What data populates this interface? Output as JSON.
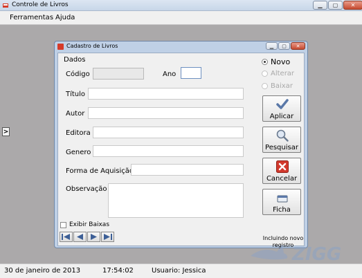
{
  "window": {
    "title": "Controle de Livros"
  },
  "menu": {
    "items": [
      "Ferramentas",
      "Ajuda"
    ]
  },
  "side_toggle": ">",
  "dialog": {
    "title": "Cadastro de Livros",
    "group_label": "Dados",
    "fields": {
      "codigo": {
        "label": "Código",
        "value": ""
      },
      "ano": {
        "label": "Ano",
        "value": ""
      },
      "titulo": {
        "label": "Título",
        "value": ""
      },
      "autor": {
        "label": "Autor",
        "value": ""
      },
      "editora": {
        "label": "Editora",
        "value": ""
      },
      "genero": {
        "label": "Genero",
        "value": ""
      },
      "forma_aquisicao": {
        "label": "Forma de Aquisição",
        "value": ""
      },
      "observacao": {
        "label": "Observação",
        "value": ""
      }
    },
    "modes": [
      {
        "label": "Novo",
        "checked": true,
        "enabled": true
      },
      {
        "label": "Alterar",
        "checked": false,
        "enabled": false
      },
      {
        "label": "Baixar",
        "checked": false,
        "enabled": false
      }
    ],
    "buttons": {
      "aplicar": "Aplicar",
      "pesquisar": "Pesquisar",
      "cancelar": "Cancelar",
      "ficha": "Ficha"
    },
    "exibir_baixas": "Exibir Baixas",
    "status_note": "Incluindo novo registro",
    "icons": {
      "aplicar": "checkmark-icon",
      "pesquisar": "magnifier-icon",
      "cancelar": "red-x-icon",
      "ficha": "card-icon"
    }
  },
  "statusbar": {
    "date": "30  de  janeiro  de  2013",
    "time": "17:54:02",
    "user": "Usuario:  Jessica"
  },
  "watermark": "ZIGG",
  "colors": {
    "desktop": "#aba9aa",
    "dialog_frame": "#bfd0e6",
    "cancel_red": "#d2392d",
    "check_blue": "#5a78a8"
  }
}
